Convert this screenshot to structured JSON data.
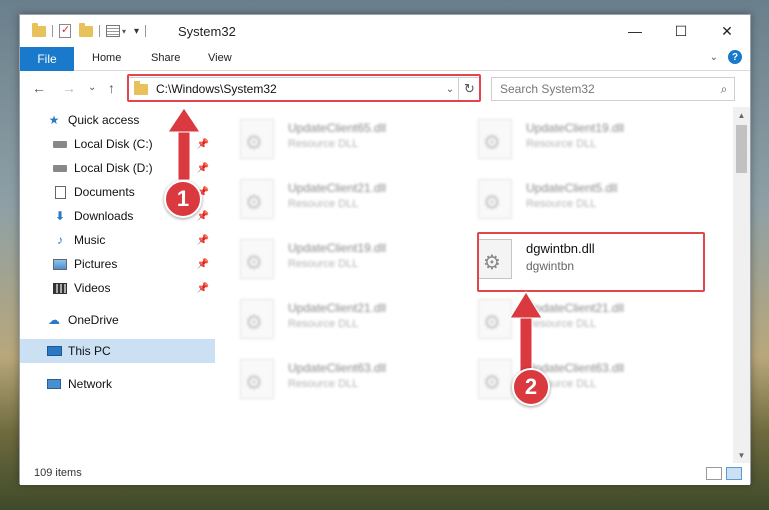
{
  "window": {
    "title": "System32",
    "controls": {
      "minimize": "—",
      "maximize": "☐",
      "close": "✕"
    }
  },
  "ribbon": {
    "file": "File",
    "tabs": [
      "Home",
      "Share",
      "View"
    ],
    "help": "?"
  },
  "nav": {
    "back": "←",
    "forward": "→",
    "recent": "⌄",
    "up": "↑",
    "address": "C:\\Windows\\System32",
    "refresh": "↻",
    "search_placeholder": "Search System32"
  },
  "sidebar": {
    "items": [
      {
        "label": "Quick access",
        "icon": "star-icon"
      },
      {
        "label": "Local Disk (C:)",
        "icon": "drive-icon",
        "pinned": true
      },
      {
        "label": "Local Disk (D:)",
        "icon": "drive-icon",
        "pinned": true
      },
      {
        "label": "Documents",
        "icon": "documents-icon",
        "pinned": true
      },
      {
        "label": "Downloads",
        "icon": "downloads-icon",
        "pinned": true
      },
      {
        "label": "Music",
        "icon": "music-icon",
        "pinned": true
      },
      {
        "label": "Pictures",
        "icon": "pictures-icon",
        "pinned": true
      },
      {
        "label": "Videos",
        "icon": "videos-icon",
        "pinned": true
      },
      {
        "label": "OneDrive",
        "icon": "onedrive-icon"
      },
      {
        "label": "This PC",
        "icon": "pc-icon",
        "selected": true
      },
      {
        "label": "Network",
        "icon": "network-icon"
      }
    ]
  },
  "files": [
    {
      "name": "UpdateClient65.dll",
      "desc": "Resource DLL"
    },
    {
      "name": "UpdateClient19.dll",
      "desc": "Resource DLL"
    },
    {
      "name": "UpdateClient21.dll",
      "desc": "Resource DLL"
    },
    {
      "name": "UpdateClient5.dll",
      "desc": "Resource DLL"
    },
    {
      "name": "UpdateClient19.dll",
      "desc": "Resource DLL"
    },
    {
      "name": "dgwintbn.dll",
      "desc": "dgwintbn"
    },
    {
      "name": "UpdateClient21.dll",
      "desc": "Resource DLL"
    },
    {
      "name": "UpdateClient21.dll",
      "desc": "Resource DLL"
    },
    {
      "name": "UpdateClient63.dll",
      "desc": "Resource DLL"
    },
    {
      "name": "UpdateClient63.dll",
      "desc": "Resource DLL"
    }
  ],
  "status": {
    "count": "109 items"
  },
  "callouts": {
    "one": "1",
    "two": "2"
  },
  "colors": {
    "accent": "#1979ca",
    "highlight": "#e0474d",
    "badge": "#d9393f",
    "selected": "#cce0f3"
  }
}
